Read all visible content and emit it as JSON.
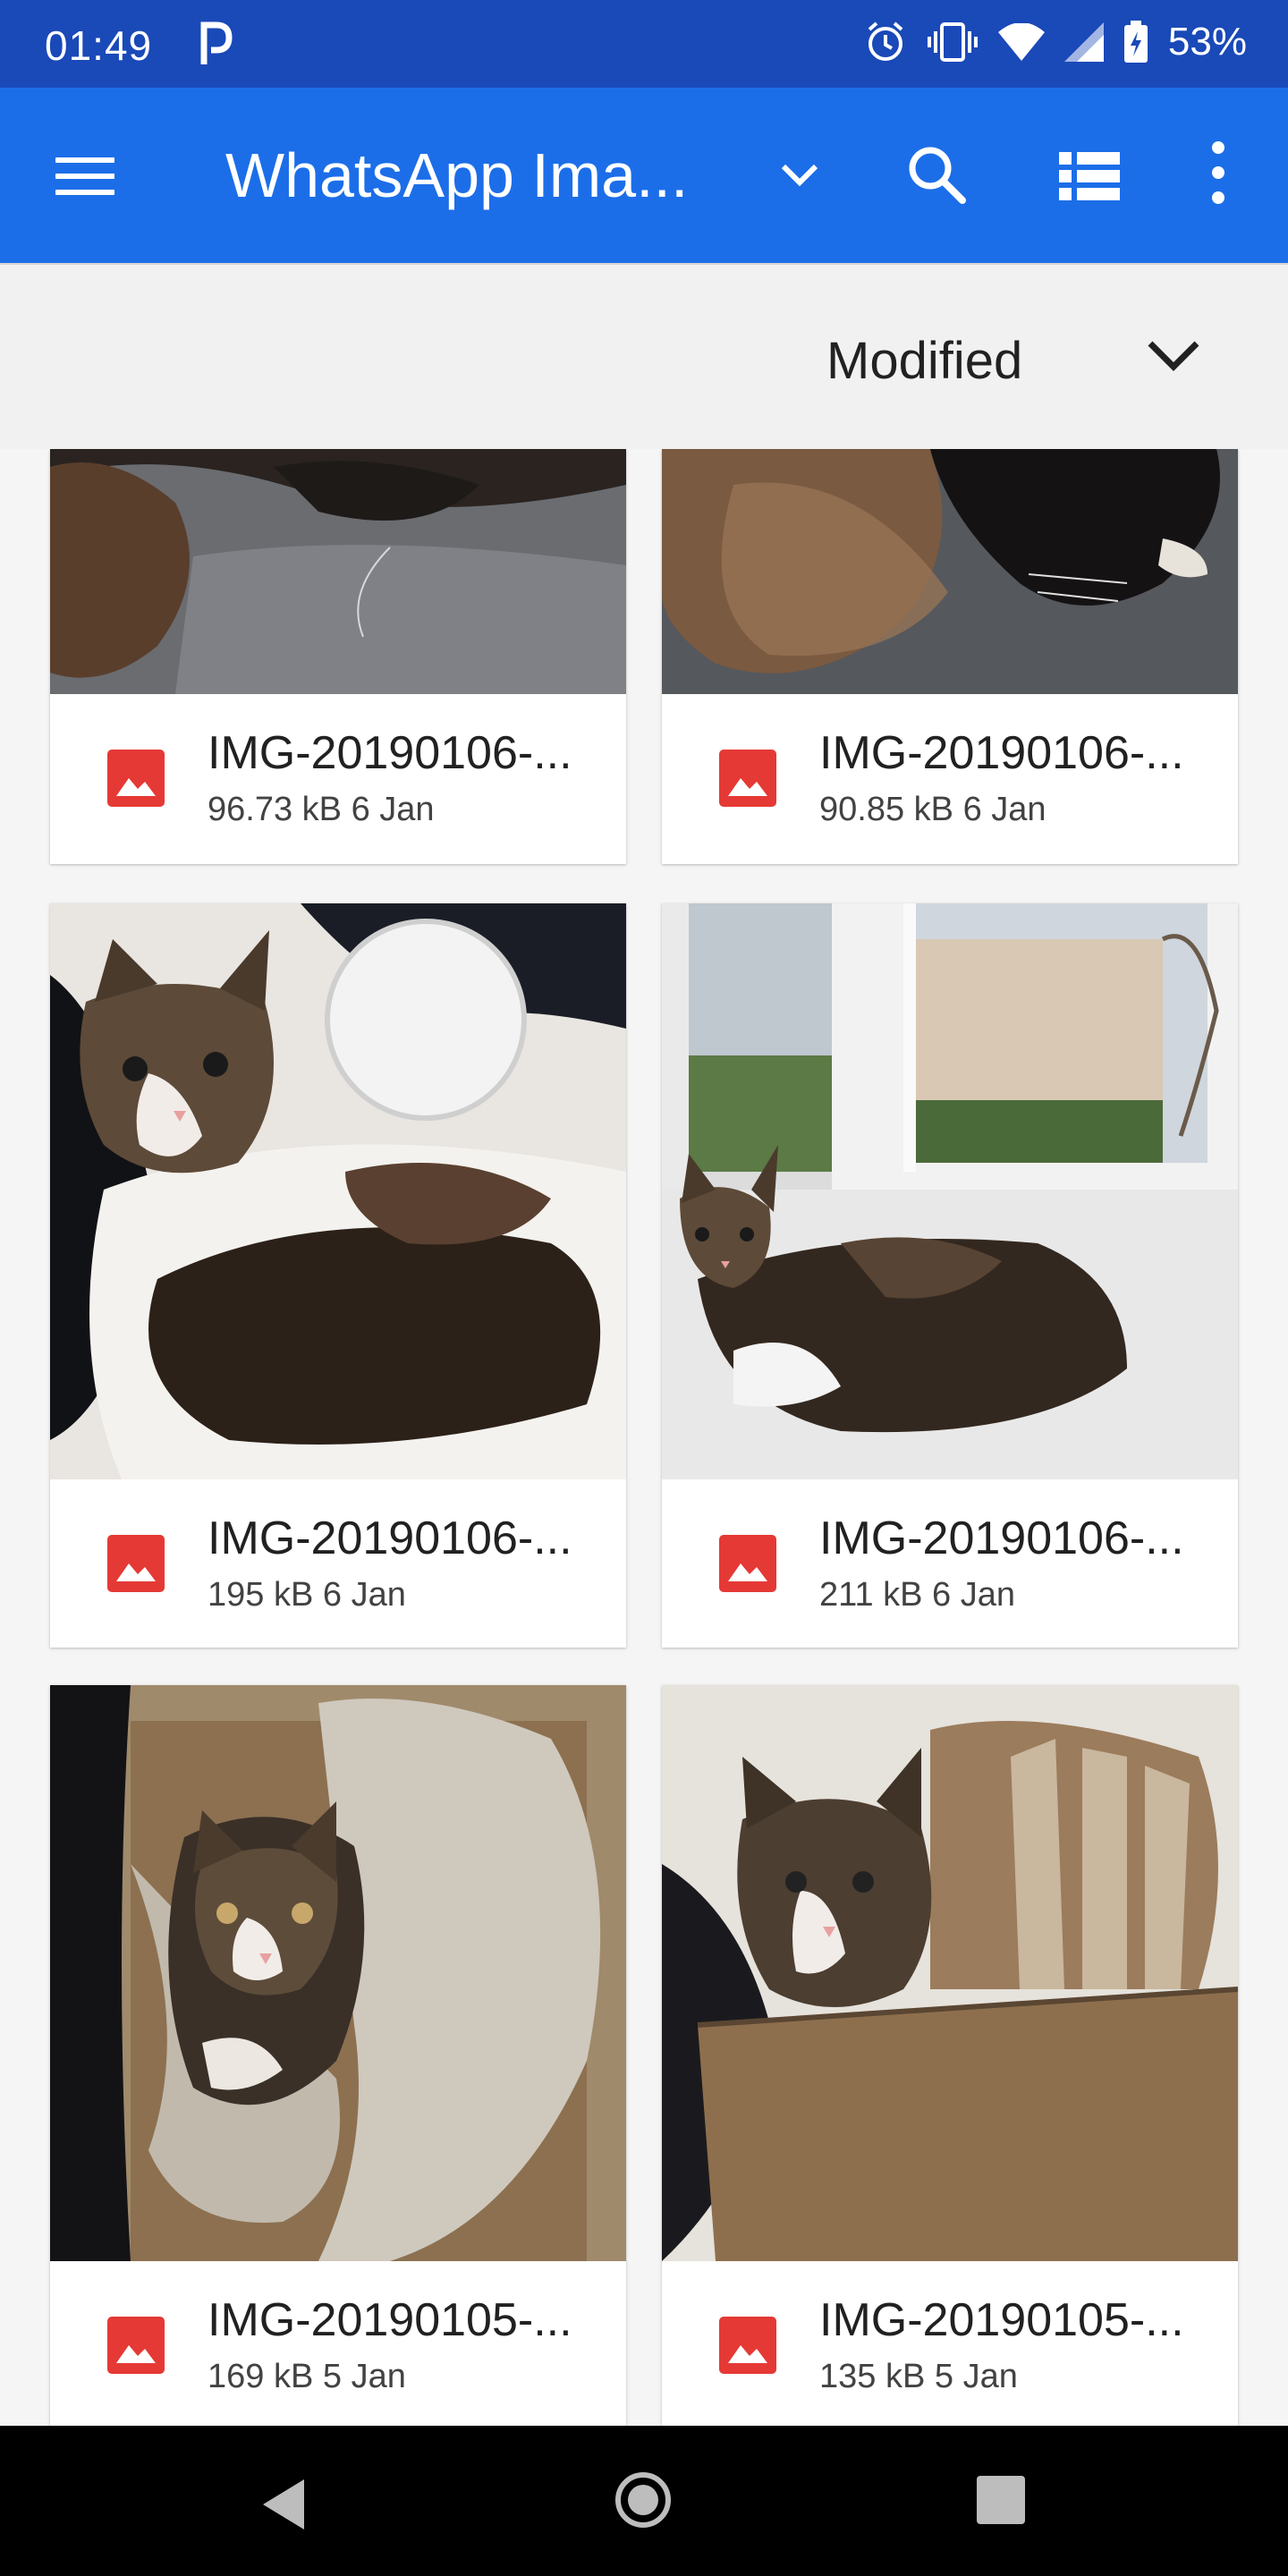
{
  "status": {
    "time": "01:49",
    "battery": "53%"
  },
  "app_bar": {
    "title": "WhatsApp Ima..."
  },
  "sort": {
    "label": "Modified"
  },
  "files": [
    {
      "name": "IMG-20190106-...",
      "size": "96.73 kB",
      "date": "6 Jan"
    },
    {
      "name": "IMG-20190106-...",
      "size": "90.85 kB",
      "date": "6 Jan"
    },
    {
      "name": "IMG-20190106-...",
      "size": "195 kB",
      "date": "6 Jan"
    },
    {
      "name": "IMG-20190106-...",
      "size": "211 kB",
      "date": "6 Jan"
    },
    {
      "name": "IMG-20190105-...",
      "size": "169 kB",
      "date": "5 Jan"
    },
    {
      "name": "IMG-20190105-...",
      "size": "135 kB",
      "date": "5 Jan"
    }
  ],
  "icons": [
    "p-icon",
    "alarm-icon",
    "vibrate-icon",
    "wifi-icon",
    "signal-icon",
    "battery-icon",
    "menu-icon",
    "chevron-down-icon",
    "search-icon",
    "list-view-icon",
    "more-vert-icon",
    "image-file-icon",
    "back-icon",
    "home-icon",
    "recents-icon"
  ],
  "colors": {
    "status_bar": "#1a49b8",
    "app_bar": "#1c6ee8",
    "file_icon": "#e53935"
  }
}
